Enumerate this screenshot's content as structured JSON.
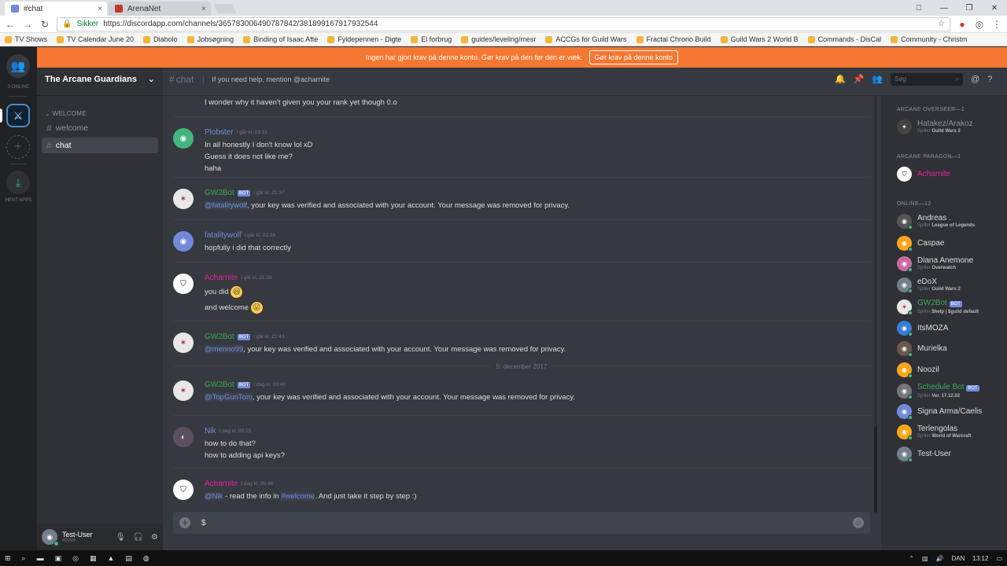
{
  "browser": {
    "tabs": [
      {
        "title": "#chat",
        "close": "×"
      },
      {
        "title": "ArenaNet",
        "close": "×"
      }
    ],
    "secure_label": "Sikker",
    "url": "https://discordapp.com/channels/365783006490787842/381899167917932544",
    "window_controls": [
      "⎕",
      "—",
      "❐",
      "✕"
    ],
    "bookmarks": [
      "TV Shows",
      "TV Calendar June 20",
      "Diabolo",
      "Jobsøgning",
      "Binding of Isaac Afte",
      "Fyldepennen - Digte",
      "El forbrug",
      "guides/leveling/mesr",
      "ACCGs for Guild Wars",
      "Fractal Chrono Build",
      "Guild Wars 2 World B",
      "Commands - DisCal",
      "Community - Christm"
    ]
  },
  "banner": {
    "text": "Ingen har gjort krav på denne konto. Gør krav på den før den er væk.",
    "button": "Gør krav på denne konto"
  },
  "servers": {
    "online_label": "0 ONLINE",
    "download_label": "HENT APPS"
  },
  "guild": {
    "name": "The Arcane Guardians",
    "category": "WELCOME",
    "channels": [
      {
        "name": "welcome"
      },
      {
        "name": "chat"
      }
    ]
  },
  "user": {
    "name": "Test-User",
    "tag": "#9399"
  },
  "chat": {
    "channel": "chat",
    "topic": "If you need help, mention @acharnite",
    "top_line": "I wonder why it haven't given you your rank yet though 0.o",
    "messages": [
      {
        "author": "Plobster",
        "time": "I går kl. 19:31",
        "lines": [
          "In all honestly I don't know lol xD",
          "Guess it does not like me?",
          "haha"
        ]
      },
      {
        "author": "GW2Bot",
        "bot": "BOT",
        "time": "I går kl. 21:37",
        "mention": "@fatalitywolf",
        "text": ", your key was verified and associated with your account. Your message was removed for privacy."
      },
      {
        "author": "fatalitywolf",
        "time": "I går kl. 21:39",
        "lines": [
          "hopfully i did that correctly"
        ]
      },
      {
        "author": "Acharnite",
        "time": "I går kl. 21:39",
        "lines": [
          "you did",
          "and welcome"
        ],
        "emojis": [
          "😃",
          "😛"
        ]
      },
      {
        "author": "GW2Bot",
        "bot": "BOT",
        "time": "I går kl. 21:43",
        "mention": "@menno99",
        "text": ", your key was verified and associated with your account. Your message was removed for privacy."
      },
      {
        "author": "GW2Bot",
        "bot": "BOT",
        "time": "I dag kl. 00:40",
        "mention": "@TopGunTom",
        "text": ", your key was verified and associated with your account. Your message was removed for privacy."
      },
      {
        "author": "Nik",
        "time": "I dag kl. 09:25",
        "lines": [
          "how to do that?",
          "how to adding api keys?"
        ]
      },
      {
        "author": "Acharnite",
        "time": "I dag kl. 09:46",
        "mention": "@Nik",
        "text": " - read the info in ",
        "channel_link": "#welcome",
        "text2": ". And just take it step by step :)"
      }
    ],
    "date_divider": "9. december 2017",
    "composer_value": "$",
    "search_placeholder": "Søg"
  },
  "members": {
    "groups": [
      {
        "title": "ARCANE OVERSEER—1",
        "members": [
          {
            "name": "Hatakez/Arakoz",
            "status": "Spiller",
            "game": "Guild Wars 2",
            "color": "#8e9297"
          }
        ]
      },
      {
        "title": "ARCANE PARAGON—1",
        "members": [
          {
            "name": "Acharnite",
            "color": "#e91e9c"
          }
        ]
      },
      {
        "title": "ONLINE—12",
        "members": [
          {
            "name": "Andreas .",
            "status": "Spiller",
            "game": "League of Legends"
          },
          {
            "name": "Caspae"
          },
          {
            "name": "Diana Anemone",
            "status": "Spiller",
            "game": "Overwatch"
          },
          {
            "name": "eDoX",
            "status": "Spiller",
            "game": "Guild Wars 2"
          },
          {
            "name": "GW2Bot",
            "bot": "BOT",
            "status": "Spiller",
            "game": "$help | $guild default",
            "color": "#3ba55d"
          },
          {
            "name": "ItsMOZA"
          },
          {
            "name": "Murielka"
          },
          {
            "name": "Noozil"
          },
          {
            "name": "Schedule Bot",
            "bot": "BOT",
            "status": "Spiller",
            "game": "Ver. 17.12.02",
            "color": "#3ba55d"
          },
          {
            "name": "Signa Arma/Caelis"
          },
          {
            "name": "Terlengolas",
            "status": "Spiller",
            "game": "World of Warcraft"
          },
          {
            "name": "Test-User"
          }
        ]
      }
    ]
  },
  "taskbar": {
    "lang": "DAN",
    "time": "13:12"
  },
  "colors": {
    "accent": "#7289da",
    "online": "#43b581",
    "banner": "#f57731"
  }
}
